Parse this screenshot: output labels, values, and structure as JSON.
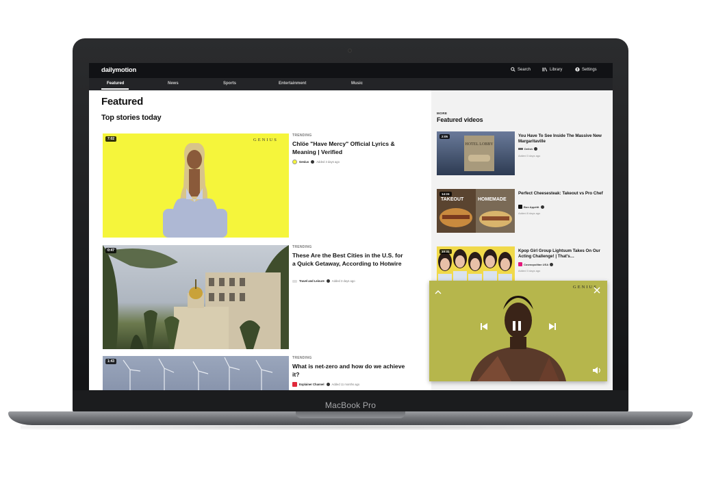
{
  "device": {
    "label": "MacBook Pro"
  },
  "header": {
    "logo": "dailymotion",
    "search_label": "Search",
    "library_label": "Library",
    "settings_label": "Settings"
  },
  "nav": {
    "tabs": [
      {
        "label": "Featured",
        "active": true
      },
      {
        "label": "News"
      },
      {
        "label": "Sports"
      },
      {
        "label": "Entertainment"
      },
      {
        "label": "Music"
      }
    ]
  },
  "main": {
    "heading": "Featured",
    "subheading": "Top stories today",
    "stories": [
      {
        "duration": "7:02",
        "tag": "TRENDING",
        "title": "Chlöe \"Have Mercy\" Official Lyrics & Meaning | Verified",
        "channel": "Genius",
        "added": "Added 3 days ago",
        "thumb_brand": "GENIUS"
      },
      {
        "duration": "0:47",
        "tag": "TRENDING",
        "title": "These Are the Best Cities in the U.S. for a Quick Getaway, According to Hotwire",
        "channel": "Travel and Leisure",
        "added": "Added 3 days ago"
      },
      {
        "duration": "1:43",
        "tag": "TRENDING",
        "title": "What is net-zero and how do we achieve it?",
        "channel": "Explainer Channel",
        "added": "Added 11 months ago"
      }
    ]
  },
  "sidebar": {
    "more_label": "MORE",
    "heading": "Featured videos",
    "videos": [
      {
        "duration": "2:05",
        "title": "You Have To See Inside The Massive New Margaritaville",
        "channel": "Delish",
        "added": "Added 3 days ago",
        "thumb_text": "HOTEL LOBBY"
      },
      {
        "duration": "14:24",
        "title": "Perfect Cheesesteak: Takeout vs Pro Chef",
        "channel": "Bon Appétit",
        "added": "Added 8 days ago",
        "thumb_left": "TAKEOUT",
        "thumb_right": "HOMEMADE"
      },
      {
        "duration": "10:31",
        "title": "Kpop Girl Group Lightsum Takes On Our Acting Challenge! | That's…",
        "channel": "Cosmopolitan USA",
        "added": "Added 3 days ago"
      }
    ]
  },
  "mini_player": {
    "brand": "GENIUS",
    "bg_color": "#b6b64c"
  },
  "colors": {
    "accent": "#f5f53b",
    "topbar": "#111215",
    "navbar": "#232427"
  }
}
